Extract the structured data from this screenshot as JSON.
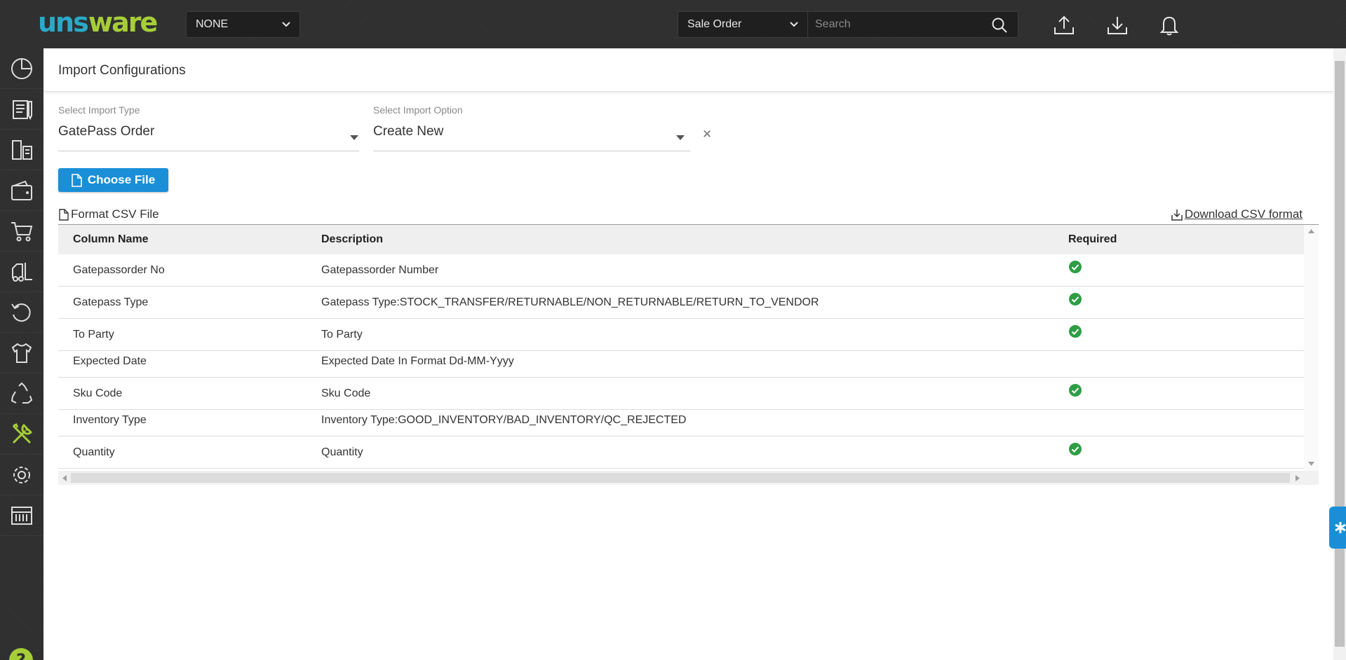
{
  "header": {
    "logo_text": "unware",
    "facility_select": "NONE",
    "search_type": "Sale Order",
    "search_placeholder": "Search"
  },
  "sidebar": {
    "items": [
      "dashboard-icon",
      "orders-icon",
      "documents-icon",
      "wallet-icon",
      "cart-icon",
      "forklift-icon",
      "returns-icon",
      "apparel-icon",
      "recycle-icon",
      "tools-icon",
      "settings-icon",
      "reports-icon"
    ],
    "active_index": 9
  },
  "page": {
    "title": "Import Configurations",
    "import_type": {
      "label": "Select Import Type",
      "value": "GatePass Order"
    },
    "import_option": {
      "label": "Select Import Option",
      "value": "Create New"
    },
    "choose_file_label": "Choose File",
    "format_label": "Format CSV File",
    "download_label": "Download CSV format"
  },
  "table": {
    "headers": [
      "Column Name",
      "Description",
      "Required"
    ],
    "rows": [
      {
        "name": "Gatepassorder No",
        "description": "Gatepassorder Number",
        "required": true
      },
      {
        "name": "Gatepass Type",
        "description": "Gatepass Type:STOCK_TRANSFER/RETURNABLE/NON_RETURNABLE/RETURN_TO_VENDOR",
        "required": true
      },
      {
        "name": "To Party",
        "description": "To Party",
        "required": true
      },
      {
        "name": "Expected Date",
        "description": "Expected Date In Format Dd-MM-Yyyy",
        "required": false
      },
      {
        "name": "Sku Code",
        "description": "Sku Code",
        "required": true
      },
      {
        "name": "Inventory Type",
        "description": "Inventory Type:GOOD_INVENTORY/BAD_INVENTORY/QC_REJECTED",
        "required": false
      },
      {
        "name": "Quantity",
        "description": "Quantity",
        "required": true
      }
    ]
  },
  "colors": {
    "topbar": "#2f2f2f",
    "accent_blue": "#1a8fd8",
    "check_green": "#2e9e45",
    "active_icon": "#a6ce39"
  }
}
